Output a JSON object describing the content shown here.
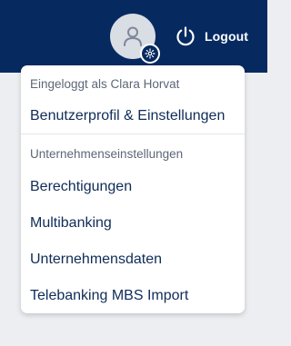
{
  "header": {
    "logout_label": "Logout"
  },
  "icons": {
    "avatar": "user-icon",
    "settings_badge": "gear-icon",
    "logout": "power-icon"
  },
  "colors": {
    "header_background": "#062a60",
    "menu_text": "#0f2c58",
    "section_text": "#5c6778"
  },
  "dropdown": {
    "logged_in_label": "Eingeloggt als Clara Horvat",
    "profile_item": "Benutzerprofil & Einstellungen",
    "company_section_label": "Unternehmenseinstellungen",
    "company_items": [
      "Berechtigungen",
      "Multibanking",
      "Unternehmensdaten",
      "Telebanking MBS Import"
    ]
  }
}
